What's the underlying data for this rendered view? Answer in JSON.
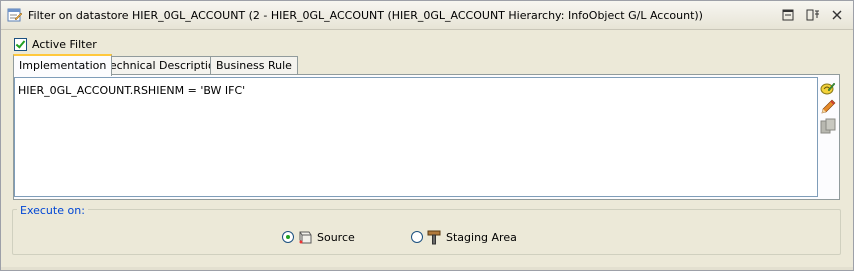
{
  "window": {
    "title": "Filter on datastore HIER_0GL_ACCOUNT (2 - HIER_0GL_ACCOUNT (HIER_0GL_ACCOUNT Hierarchy: InfoObject G/L Account))",
    "icon": "edit-window-icon",
    "controls": [
      "maximize-icon",
      "pin-icon",
      "close-icon"
    ]
  },
  "filter": {
    "active_label": "Active Filter",
    "active_checked": true
  },
  "tabs": [
    {
      "label": "Implementation",
      "active": true
    },
    {
      "label": "Technical Description",
      "active": false
    },
    {
      "label": "Business Rule",
      "active": false
    }
  ],
  "editor": {
    "expression": "HIER_0GL_ACCOUNT.RSHIENM = 'BW IFC'",
    "side_icons": [
      "expression-editor-icon",
      "edit-pencil-icon",
      "check-expression-icon"
    ]
  },
  "execute_on": {
    "legend": "Execute on:",
    "options": [
      {
        "label": "Source",
        "selected": true,
        "icon": "source-icon"
      },
      {
        "label": "Staging Area",
        "selected": false,
        "icon": "staging-area-icon"
      }
    ]
  },
  "colors": {
    "legend_text": "#0046d5",
    "active_tab_accent": "#ffc83c",
    "check_mark": "#21a121"
  }
}
